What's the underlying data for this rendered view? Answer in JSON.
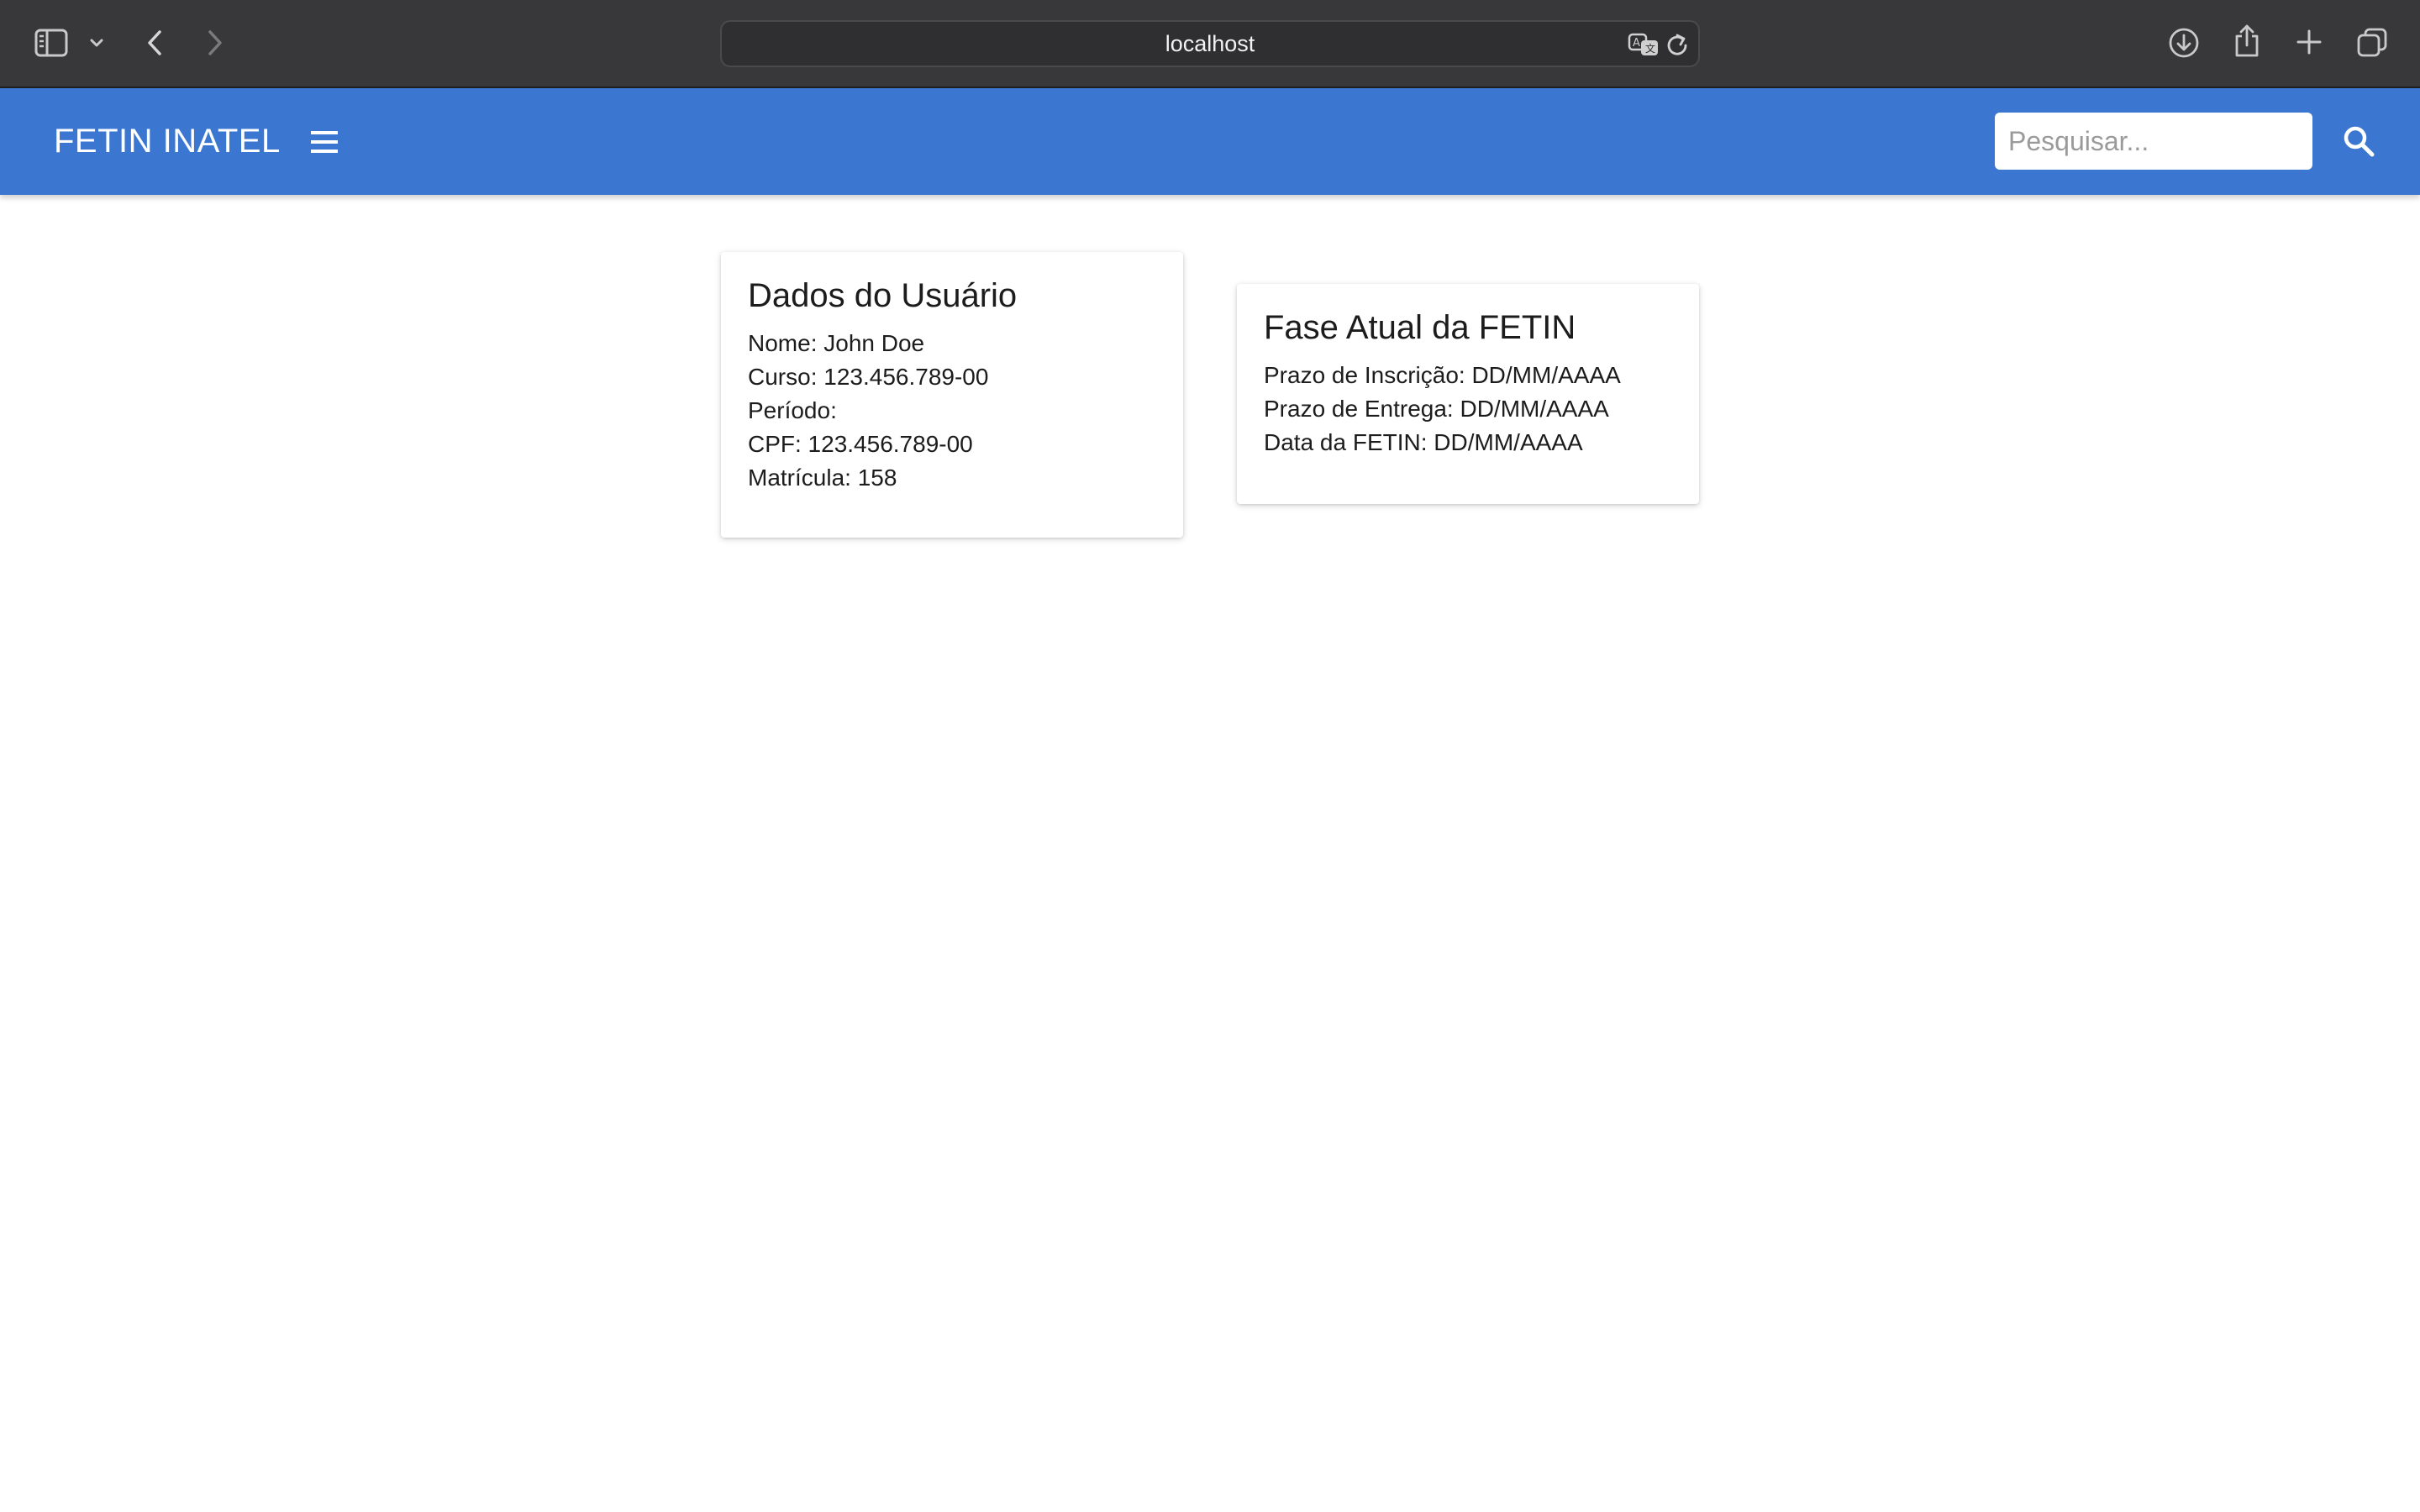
{
  "browser": {
    "url": "localhost"
  },
  "app": {
    "title": "FETIN INATEL",
    "search_placeholder": "Pesquisar...",
    "accent_color": "#3b77d0"
  },
  "user_card": {
    "title": "Dados do Usuário",
    "lines": [
      "Nome: John Doe",
      "Curso: 123.456.789-00",
      "Período:",
      "CPF: 123.456.789-00",
      "Matrícula: 158"
    ]
  },
  "fase_card": {
    "title": "Fase Atual da FETIN",
    "lines": [
      "Prazo de Inscrição: DD/MM/AAAA",
      "Prazo de Entrega: DD/MM/AAAA",
      "Data da FETIN: DD/MM/AAAA"
    ]
  },
  "icons": {
    "sidebar": "sidebar-icon",
    "tab_overview_chevron": "chevron-down-icon",
    "back": "back-arrow-icon",
    "forward": "forward-arrow-icon",
    "translate": "translate-icon",
    "reload": "reload-icon",
    "download": "download-icon",
    "share": "share-icon",
    "new_tab": "plus-icon",
    "tabs": "tabs-icon",
    "menu": "hamburger-menu-icon",
    "search": "search-icon"
  }
}
